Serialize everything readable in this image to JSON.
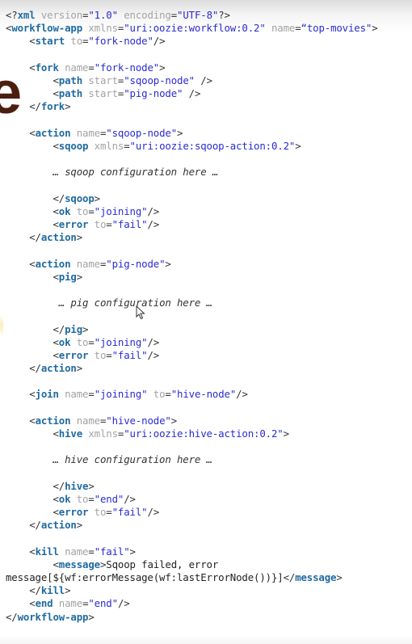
{
  "editor": {
    "lines": [
      [
        {
          "t": "br",
          "v": "<?"
        },
        {
          "t": "tag",
          "v": "xml"
        },
        {
          "t": "attr",
          "v": " version"
        },
        {
          "t": "br",
          "v": "="
        },
        {
          "t": "val",
          "v": "\"1.0\""
        },
        {
          "t": "attr",
          "v": " encoding"
        },
        {
          "t": "br",
          "v": "="
        },
        {
          "t": "val",
          "v": "\"UTF-8\""
        },
        {
          "t": "br",
          "v": "?>"
        }
      ],
      [
        {
          "t": "br",
          "v": "<"
        },
        {
          "t": "tag",
          "v": "workflow-app"
        },
        {
          "t": "attr",
          "v": " xmlns"
        },
        {
          "t": "br",
          "v": "="
        },
        {
          "t": "val",
          "v": "\"uri:oozie:workflow:0.2\""
        },
        {
          "t": "attr",
          "v": " name"
        },
        {
          "t": "br",
          "v": "="
        },
        {
          "t": "val",
          "v": "“top-movies\""
        },
        {
          "t": "br",
          "v": ">"
        }
      ],
      [
        {
          "t": "txt",
          "v": "    "
        },
        {
          "t": "br",
          "v": "<"
        },
        {
          "t": "tag",
          "v": "start"
        },
        {
          "t": "attr",
          "v": " to"
        },
        {
          "t": "br",
          "v": "="
        },
        {
          "t": "val",
          "v": "\"fork-node\""
        },
        {
          "t": "br",
          "v": "/>"
        }
      ],
      [],
      [
        {
          "t": "txt",
          "v": "    "
        },
        {
          "t": "br",
          "v": "<"
        },
        {
          "t": "tag",
          "v": "fork"
        },
        {
          "t": "attr",
          "v": " name"
        },
        {
          "t": "br",
          "v": "="
        },
        {
          "t": "val",
          "v": "\"fork-node\""
        },
        {
          "t": "br",
          "v": ">"
        }
      ],
      [
        {
          "t": "txt",
          "v": "        "
        },
        {
          "t": "br",
          "v": "<"
        },
        {
          "t": "tag",
          "v": "path"
        },
        {
          "t": "attr",
          "v": " start"
        },
        {
          "t": "br",
          "v": "="
        },
        {
          "t": "val",
          "v": "\"sqoop-node\""
        },
        {
          "t": "br",
          "v": " />"
        }
      ],
      [
        {
          "t": "txt",
          "v": "        "
        },
        {
          "t": "br",
          "v": "<"
        },
        {
          "t": "tag",
          "v": "path"
        },
        {
          "t": "attr",
          "v": " start"
        },
        {
          "t": "br",
          "v": "="
        },
        {
          "t": "val",
          "v": "\"pig-node\""
        },
        {
          "t": "br",
          "v": " />"
        }
      ],
      [
        {
          "t": "txt",
          "v": "    "
        },
        {
          "t": "br",
          "v": "</"
        },
        {
          "t": "tag",
          "v": "fork"
        },
        {
          "t": "br",
          "v": ">"
        }
      ],
      [],
      [
        {
          "t": "txt",
          "v": "    "
        },
        {
          "t": "br",
          "v": "<"
        },
        {
          "t": "tag",
          "v": "action"
        },
        {
          "t": "attr",
          "v": " name"
        },
        {
          "t": "br",
          "v": "="
        },
        {
          "t": "val",
          "v": "\"sqoop-node\""
        },
        {
          "t": "br",
          "v": ">"
        }
      ],
      [
        {
          "t": "txt",
          "v": "        "
        },
        {
          "t": "br",
          "v": "<"
        },
        {
          "t": "tag",
          "v": "sqoop"
        },
        {
          "t": "attr",
          "v": " xmlns"
        },
        {
          "t": "br",
          "v": "="
        },
        {
          "t": "val",
          "v": "\"uri:oozie:sqoop-action:0.2\""
        },
        {
          "t": "br",
          "v": ">"
        }
      ],
      [],
      [
        {
          "t": "txt",
          "v": "        "
        },
        {
          "t": "cmt",
          "v": "… sqoop configuration here …"
        }
      ],
      [],
      [
        {
          "t": "txt",
          "v": "        "
        },
        {
          "t": "br",
          "v": "</"
        },
        {
          "t": "tag",
          "v": "sqoop"
        },
        {
          "t": "br",
          "v": ">"
        }
      ],
      [
        {
          "t": "txt",
          "v": "        "
        },
        {
          "t": "br",
          "v": "<"
        },
        {
          "t": "tag",
          "v": "ok"
        },
        {
          "t": "attr",
          "v": " to"
        },
        {
          "t": "br",
          "v": "="
        },
        {
          "t": "val",
          "v": "\"joining\""
        },
        {
          "t": "br",
          "v": "/>"
        }
      ],
      [
        {
          "t": "txt",
          "v": "        "
        },
        {
          "t": "br",
          "v": "<"
        },
        {
          "t": "tag",
          "v": "error"
        },
        {
          "t": "attr",
          "v": " to"
        },
        {
          "t": "br",
          "v": "="
        },
        {
          "t": "val",
          "v": "\"fail\""
        },
        {
          "t": "br",
          "v": "/>"
        }
      ],
      [
        {
          "t": "txt",
          "v": "    "
        },
        {
          "t": "br",
          "v": "</"
        },
        {
          "t": "tag",
          "v": "action"
        },
        {
          "t": "br",
          "v": ">"
        }
      ],
      [],
      [
        {
          "t": "txt",
          "v": "    "
        },
        {
          "t": "br",
          "v": "<"
        },
        {
          "t": "tag",
          "v": "action"
        },
        {
          "t": "attr",
          "v": " name"
        },
        {
          "t": "br",
          "v": "="
        },
        {
          "t": "val",
          "v": "\"pig-node\""
        },
        {
          "t": "br",
          "v": ">"
        }
      ],
      [
        {
          "t": "txt",
          "v": "        "
        },
        {
          "t": "br",
          "v": "<"
        },
        {
          "t": "tag",
          "v": "pig"
        },
        {
          "t": "br",
          "v": ">"
        }
      ],
      [],
      [
        {
          "t": "txt",
          "v": "         "
        },
        {
          "t": "cmt",
          "v": "… pig configuration here …"
        }
      ],
      [],
      [
        {
          "t": "txt",
          "v": "        "
        },
        {
          "t": "br",
          "v": "</"
        },
        {
          "t": "tag",
          "v": "pig"
        },
        {
          "t": "br",
          "v": ">"
        }
      ],
      [
        {
          "t": "txt",
          "v": "        "
        },
        {
          "t": "br",
          "v": "<"
        },
        {
          "t": "tag",
          "v": "ok"
        },
        {
          "t": "attr",
          "v": " to"
        },
        {
          "t": "br",
          "v": "="
        },
        {
          "t": "val",
          "v": "\"joining\""
        },
        {
          "t": "br",
          "v": "/>"
        }
      ],
      [
        {
          "t": "txt",
          "v": "        "
        },
        {
          "t": "br",
          "v": "<"
        },
        {
          "t": "tag",
          "v": "error"
        },
        {
          "t": "attr",
          "v": " to"
        },
        {
          "t": "br",
          "v": "="
        },
        {
          "t": "val",
          "v": "\"fail\""
        },
        {
          "t": "br",
          "v": "/>"
        }
      ],
      [
        {
          "t": "txt",
          "v": "    "
        },
        {
          "t": "br",
          "v": "</"
        },
        {
          "t": "tag",
          "v": "action"
        },
        {
          "t": "br",
          "v": ">"
        }
      ],
      [],
      [
        {
          "t": "txt",
          "v": "    "
        },
        {
          "t": "br",
          "v": "<"
        },
        {
          "t": "tag",
          "v": "join"
        },
        {
          "t": "attr",
          "v": " name"
        },
        {
          "t": "br",
          "v": "="
        },
        {
          "t": "val",
          "v": "\"joining\""
        },
        {
          "t": "attr",
          "v": " to"
        },
        {
          "t": "br",
          "v": "="
        },
        {
          "t": "val",
          "v": "\"hive-node\""
        },
        {
          "t": "br",
          "v": "/>"
        }
      ],
      [],
      [
        {
          "t": "txt",
          "v": "    "
        },
        {
          "t": "br",
          "v": "<"
        },
        {
          "t": "tag",
          "v": "action"
        },
        {
          "t": "attr",
          "v": " name"
        },
        {
          "t": "br",
          "v": "="
        },
        {
          "t": "val",
          "v": "\"hive-node\""
        },
        {
          "t": "br",
          "v": ">"
        }
      ],
      [
        {
          "t": "txt",
          "v": "        "
        },
        {
          "t": "br",
          "v": "<"
        },
        {
          "t": "tag",
          "v": "hive"
        },
        {
          "t": "attr",
          "v": " xmlns"
        },
        {
          "t": "br",
          "v": "="
        },
        {
          "t": "val",
          "v": "\"uri:oozie:hive-action:0.2\""
        },
        {
          "t": "br",
          "v": ">"
        }
      ],
      [],
      [
        {
          "t": "txt",
          "v": "        "
        },
        {
          "t": "cmt",
          "v": "… hive configuration here …"
        }
      ],
      [],
      [
        {
          "t": "txt",
          "v": "        "
        },
        {
          "t": "br",
          "v": "</"
        },
        {
          "t": "tag",
          "v": "hive"
        },
        {
          "t": "br",
          "v": ">"
        }
      ],
      [
        {
          "t": "txt",
          "v": "        "
        },
        {
          "t": "br",
          "v": "<"
        },
        {
          "t": "tag",
          "v": "ok"
        },
        {
          "t": "attr",
          "v": " to"
        },
        {
          "t": "br",
          "v": "="
        },
        {
          "t": "val",
          "v": "\"end\""
        },
        {
          "t": "br",
          "v": "/>"
        }
      ],
      [
        {
          "t": "txt",
          "v": "        "
        },
        {
          "t": "br",
          "v": "<"
        },
        {
          "t": "tag",
          "v": "error"
        },
        {
          "t": "attr",
          "v": " to"
        },
        {
          "t": "br",
          "v": "="
        },
        {
          "t": "val",
          "v": "\"fail\""
        },
        {
          "t": "br",
          "v": "/>"
        }
      ],
      [
        {
          "t": "txt",
          "v": "    "
        },
        {
          "t": "br",
          "v": "</"
        },
        {
          "t": "tag",
          "v": "action"
        },
        {
          "t": "br",
          "v": ">"
        }
      ],
      [],
      [
        {
          "t": "txt",
          "v": "    "
        },
        {
          "t": "br",
          "v": "<"
        },
        {
          "t": "tag",
          "v": "kill"
        },
        {
          "t": "attr",
          "v": " name"
        },
        {
          "t": "br",
          "v": "="
        },
        {
          "t": "val",
          "v": "\"fail\""
        },
        {
          "t": "br",
          "v": ">"
        }
      ],
      [
        {
          "t": "txt",
          "v": "        "
        },
        {
          "t": "br",
          "v": "<"
        },
        {
          "t": "tag",
          "v": "message"
        },
        {
          "t": "br",
          "v": ">"
        },
        {
          "t": "txt",
          "v": "Sqoop failed, error"
        }
      ],
      [
        {
          "t": "txt",
          "v": "message[${wf:errorMessage(wf:lastErrorNode())}]"
        },
        {
          "t": "br",
          "v": "</"
        },
        {
          "t": "tag",
          "v": "message"
        },
        {
          "t": "br",
          "v": ">"
        }
      ],
      [
        {
          "t": "txt",
          "v": "    "
        },
        {
          "t": "br",
          "v": "</"
        },
        {
          "t": "tag",
          "v": "kill"
        },
        {
          "t": "br",
          "v": ">"
        }
      ],
      [
        {
          "t": "txt",
          "v": "    "
        },
        {
          "t": "br",
          "v": "<"
        },
        {
          "t": "tag",
          "v": "end"
        },
        {
          "t": "attr",
          "v": " name"
        },
        {
          "t": "br",
          "v": "="
        },
        {
          "t": "val",
          "v": "\"end\""
        },
        {
          "t": "br",
          "v": "/>"
        }
      ],
      [
        {
          "t": "br",
          "v": "</"
        },
        {
          "t": "tag",
          "v": "workflow-app"
        },
        {
          "t": "br",
          "v": ">"
        }
      ]
    ]
  },
  "background": {
    "partial_glyph": "e"
  },
  "colors": {
    "tag": "#1f6aa0",
    "attribute": "#a3a3a3",
    "value": "#2b2bd0",
    "bracket": "#333333",
    "text": "#222222"
  },
  "icons": {
    "cursor": "mouse-pointer-icon"
  }
}
